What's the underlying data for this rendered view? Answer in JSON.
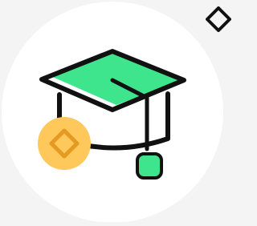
{
  "canvas": {
    "background": "#f4f4f4"
  },
  "illustration": {
    "name": "graduation-cap-illustration",
    "circle_color": "#ffffff",
    "cap_color": "#3ee58c",
    "outline_color": "#111111",
    "tassel_color": "#3ee58c"
  },
  "badge": {
    "icon": "diamond-icon",
    "fill_color": "#ffc85a",
    "icon_color": "#e59a22"
  },
  "corner_action": {
    "icon": "diamond-outline-icon",
    "stroke_color": "#111111"
  }
}
